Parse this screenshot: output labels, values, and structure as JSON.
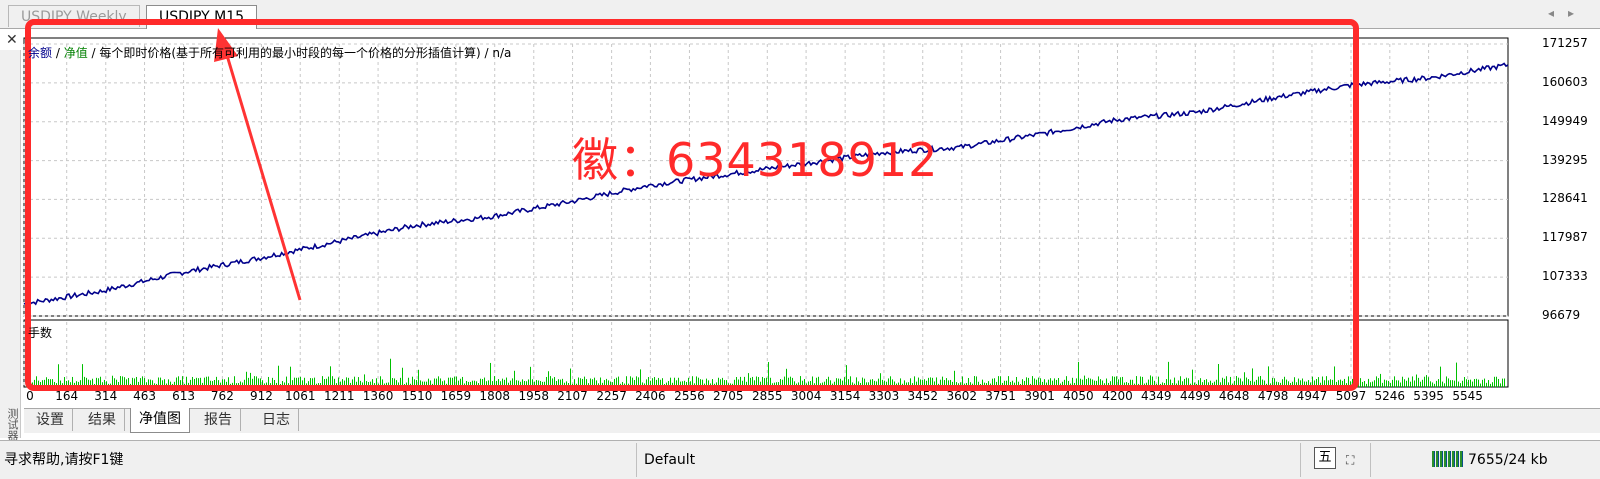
{
  "tabs": [
    {
      "label": "USDJPY,Weekly",
      "active": false
    },
    {
      "label": "USDJPY,M15",
      "active": true
    }
  ],
  "legend": {
    "balance": "余额",
    "sep1": " / ",
    "equity": "净值",
    "rest": " / 每个即时价格(基于所有可利用的最小时段的每一个价格的分形插值计算) / n/a"
  },
  "volume_label": "手数",
  "watermark": "徽：634318912",
  "side_label": "测试器",
  "chart_data": {
    "type": "line",
    "title": "",
    "xlabel": "",
    "ylabel": "",
    "x_ticks": [
      "0",
      "164",
      "314",
      "463",
      "613",
      "762",
      "912",
      "1061",
      "1211",
      "1360",
      "1510",
      "1659",
      "1808",
      "1958",
      "2107",
      "2257",
      "2406",
      "2556",
      "2705",
      "2855",
      "3004",
      "3154",
      "3303",
      "3452",
      "3602",
      "3751",
      "3901",
      "4050",
      "4200",
      "4349",
      "4499",
      "4648",
      "4798",
      "4947",
      "5097",
      "5246",
      "5395",
      "5545"
    ],
    "y_ticks": [
      "171257",
      "160603",
      "149949",
      "139295",
      "128641",
      "117987",
      "107333",
      "96679"
    ],
    "ylim": [
      96679,
      171257
    ],
    "xlim": [
      0,
      5700
    ],
    "series": [
      {
        "name": "净值",
        "color": "#00008b",
        "x": [
          0,
          300,
          600,
          900,
          1200,
          1500,
          1800,
          2100,
          2400,
          2700,
          3000,
          3300,
          3600,
          3900,
          4200,
          4500,
          4800,
          5100,
          5400,
          5700
        ],
        "y": [
          100000,
          103500,
          108500,
          112500,
          117000,
          121500,
          124000,
          128000,
          132500,
          135500,
          138500,
          141500,
          143000,
          146500,
          150500,
          152500,
          156500,
          160000,
          162000,
          165500
        ]
      }
    ],
    "volume_color": "#00c000",
    "grid": true
  },
  "bottom_tabs": [
    "设置",
    "结果",
    "净值图",
    "报告",
    "日志"
  ],
  "bottom_active": "净值图",
  "status": {
    "help": "寻求帮助,请按F1键",
    "profile": "Default",
    "icon_glyph": "五",
    "traffic": "7655/24 kb"
  }
}
